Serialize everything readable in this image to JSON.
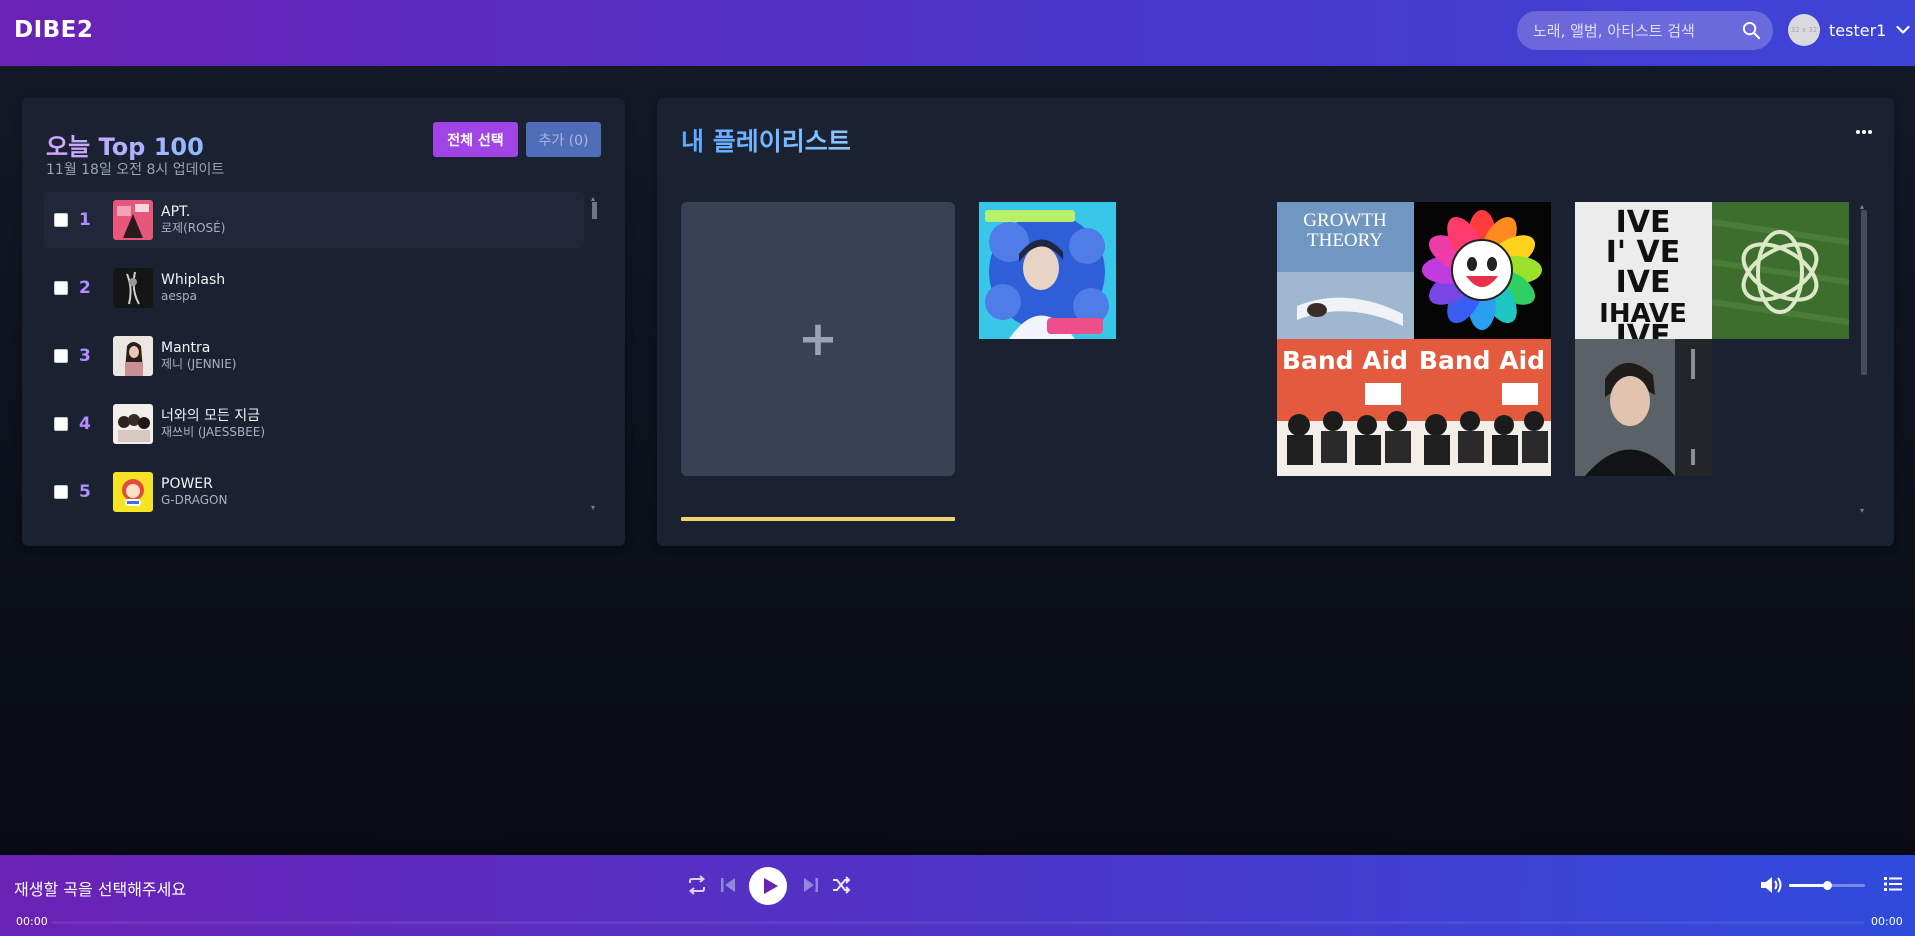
{
  "header": {
    "logo": "DIBE2",
    "search_placeholder": "노래, 앨범, 아티스트 검색",
    "avatar_alt": "32 x 32",
    "username": "tester1",
    "icons": [
      "search-icon",
      "chevron-down-icon"
    ]
  },
  "top100": {
    "title": "오늘 Top 100",
    "subtitle": "11월 18일 오전 8시 업데이트",
    "select_all_label": "전체 선택",
    "add_label": "추가 (0)",
    "songs": [
      {
        "rank": "1",
        "title": "APT.",
        "artist": "로제(ROSÉ)",
        "cover_color": "#e8577a"
      },
      {
        "rank": "2",
        "title": "Whiplash",
        "artist": "aespa",
        "cover_color": "#1b1b1b"
      },
      {
        "rank": "3",
        "title": "Mantra",
        "artist": "제니 (JENNIE)",
        "cover_color": "#e7e0da"
      },
      {
        "rank": "4",
        "title": "너와의 모든 지금",
        "artist": "재쓰비 (JAESSBEE)",
        "cover_color": "#f2ede9"
      },
      {
        "rank": "5",
        "title": "POWER",
        "artist": "G-DRAGON",
        "cover_color": "#f5e324"
      }
    ]
  },
  "playlists": {
    "title": "내 플레이리스트",
    "add_tile_symbol": "+",
    "album_art": [
      {
        "name": "album-art-blue-flowers",
        "color": "#2f5fd8"
      },
      {
        "name": "album-art-growth-theory",
        "text": "GROWTH THEORY",
        "color": "#5e86b4"
      },
      {
        "name": "album-art-rainbow-flower",
        "color": "#000000"
      },
      {
        "name": "album-art-band-aid-1",
        "text": "Band Aid",
        "color": "#e35a3e"
      },
      {
        "name": "album-art-band-aid-2",
        "text": "Band Aid",
        "color": "#e35a3e"
      },
      {
        "name": "album-art-ive",
        "text": "IVE I'VE IVE IHAVE IVE",
        "color": "#ececec"
      },
      {
        "name": "album-art-green-field",
        "color": "#3d6e2e"
      },
      {
        "name": "album-art-portrait",
        "color": "#202326"
      }
    ]
  },
  "player": {
    "now_playing": "재생할 곡을 선택해주세요",
    "current_time": "00:00",
    "total_time": "00:00",
    "progress": 0,
    "volume": 0.5,
    "icons": [
      "repeat-icon",
      "previous-icon",
      "play-icon",
      "next-icon",
      "shuffle-icon",
      "volume-icon",
      "queue-icon"
    ]
  },
  "colors": {
    "accent_purple": "#a044e6",
    "header_gradient_start": "#6a22b5",
    "header_gradient_end": "#3d44d6",
    "rank_color": "#b38cff",
    "underline_yellow": "#f2d36b"
  }
}
